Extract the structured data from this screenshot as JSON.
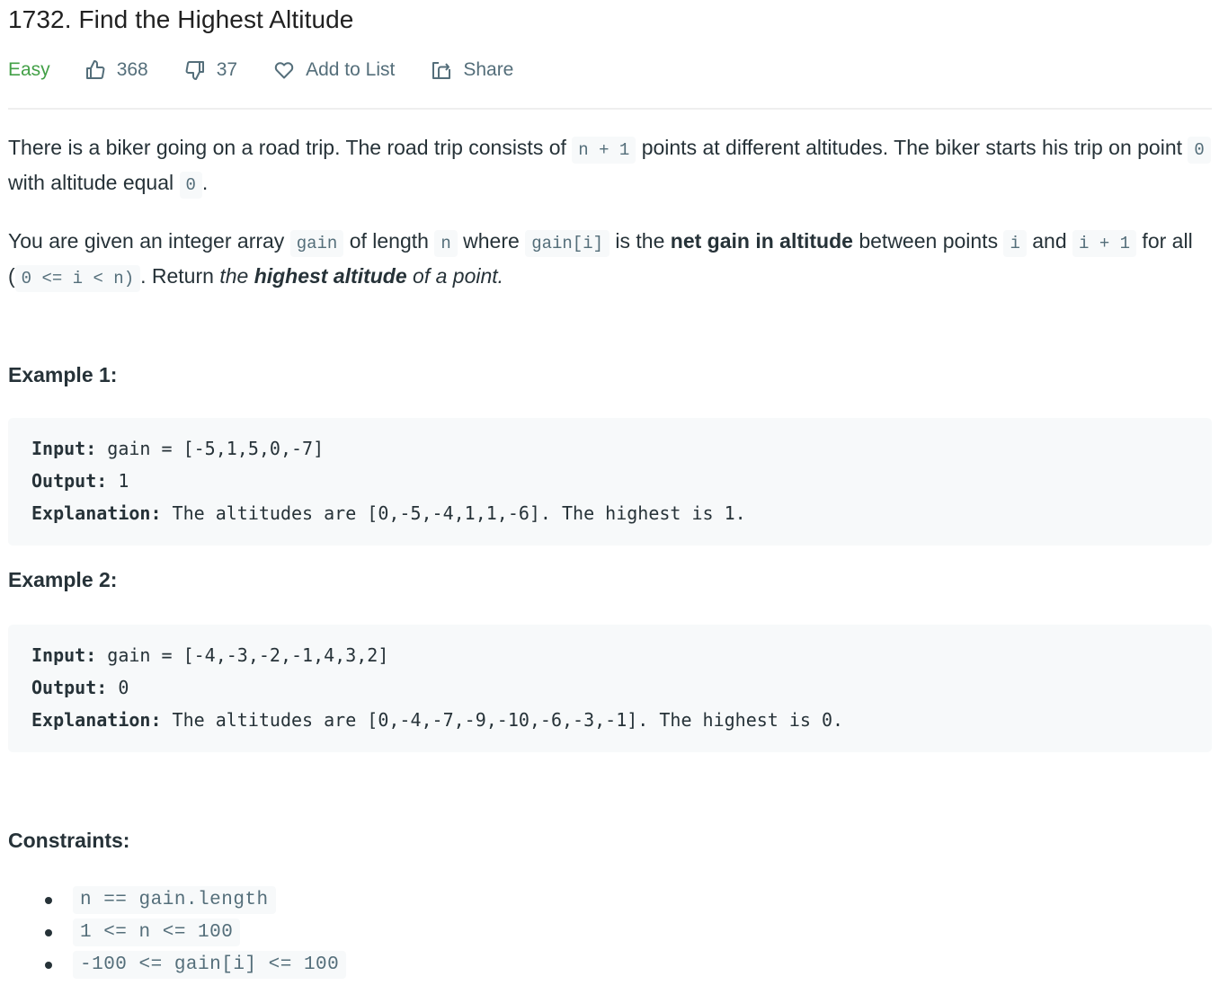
{
  "problem": {
    "title": "1732. Find the Highest Altitude",
    "difficulty": "Easy",
    "likes": "368",
    "dislikes": "37",
    "add_to_list_label": "Add to List",
    "share_label": "Share"
  },
  "colors": {
    "difficulty_easy": "#43a047",
    "meta_text": "#546e7a",
    "body_text": "#263238",
    "code_bg": "#f7f9fa"
  },
  "icons": {
    "like": "thumbs-up-icon",
    "dislike": "thumbs-down-icon",
    "favorite": "heart-icon",
    "share": "share-icon"
  },
  "description": {
    "p1": {
      "t1": "There is a biker going on a road trip. The road trip consists of ",
      "c1": "n + 1",
      "t2": " points at different altitudes. The biker starts his trip on point ",
      "c2": "0",
      "t3": " with altitude equal ",
      "c3": "0",
      "t4": "."
    },
    "p2": {
      "t1": "You are given an integer array ",
      "c1": "gain",
      "t2": " of length ",
      "c2": "n",
      "t3": " where ",
      "c3": "gain[i]",
      "t4": " is the ",
      "b1": "net gain in altitude",
      "t5": " between points ",
      "c4": "i",
      "t6": " and ",
      "c5": "i + 1",
      "t7": " for all (",
      "c6": "0 <= i < n)",
      "t8": ". Return ",
      "i1": "the ",
      "bi1": "highest altitude",
      "i2": " of a point."
    }
  },
  "examples": [
    {
      "heading": "Example 1:",
      "input_label": "Input:",
      "input": " gain = [-5,1,5,0,-7]",
      "output_label": "Output:",
      "output": " 1",
      "explanation_label": "Explanation:",
      "explanation": " The altitudes are [0,-5,-4,1,1,-6]. The highest is 1."
    },
    {
      "heading": "Example 2:",
      "input_label": "Input:",
      "input": " gain = [-4,-3,-2,-1,4,3,2]",
      "output_label": "Output:",
      "output": " 0",
      "explanation_label": "Explanation:",
      "explanation": " The altitudes are [0,-4,-7,-9,-10,-6,-3,-1]. The highest is 0."
    }
  ],
  "constraints": {
    "heading": "Constraints:",
    "items": [
      "n == gain.length",
      "1 <= n <= 100",
      "-100 <= gain[i] <= 100"
    ]
  }
}
